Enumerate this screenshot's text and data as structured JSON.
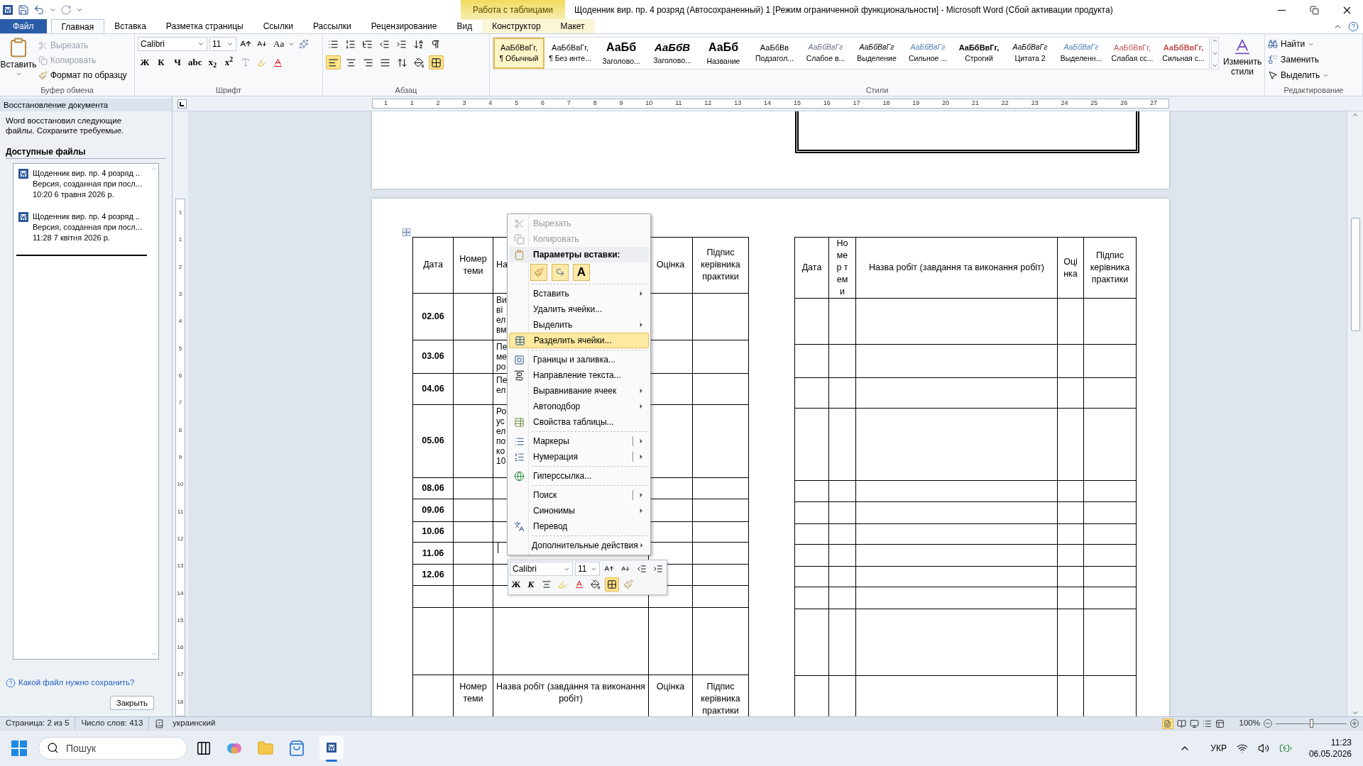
{
  "title_bar": {
    "contextual_group": "Работа с таблицами",
    "title": "Щоденник вир. пр. 4 розряд (Автосохраненный) 1 [Режим ограниченной функциональности]  -  Microsoft Word (Сбой активации продукта)"
  },
  "tabs": [
    {
      "label": "Файл",
      "kind": "file",
      "selected": false
    },
    {
      "label": "Главная",
      "kind": "normal",
      "selected": true
    },
    {
      "label": "Вставка",
      "kind": "normal",
      "selected": false
    },
    {
      "label": "Разметка страницы",
      "kind": "normal",
      "selected": false
    },
    {
      "label": "Ссылки",
      "kind": "normal",
      "selected": false
    },
    {
      "label": "Рассылки",
      "kind": "normal",
      "selected": false
    },
    {
      "label": "Рецензирование",
      "kind": "normal",
      "selected": false
    },
    {
      "label": "Вид",
      "kind": "normal",
      "selected": false
    },
    {
      "label": "Конструктор",
      "kind": "contextual",
      "selected": false
    },
    {
      "label": "Макет",
      "kind": "contextual",
      "selected": false
    }
  ],
  "ribbon": {
    "clipboard": {
      "label": "Буфер обмена",
      "paste": "Вставить",
      "cut": {
        "label": "Вырезать",
        "disabled": true
      },
      "copy": {
        "label": "Копировать",
        "disabled": true
      },
      "format_painter": "Формат по образцу"
    },
    "font": {
      "label": "Шрифт",
      "font_name": "Calibri",
      "font_size": "11",
      "case_button": "Aa",
      "style_buttons": [
        "Ж",
        "К",
        "Ч",
        "abc",
        "x$_{2}$",
        "x$^{2}$"
      ]
    },
    "paragraph": {
      "label": "Абзац",
      "align_buttons": [
        {
          "selected": true
        },
        {
          "selected": false
        },
        {
          "selected": false
        },
        {
          "selected": false
        }
      ],
      "borders_active": true
    },
    "styles": {
      "label": "Стили",
      "change_styles": "Изменить стили",
      "items": [
        {
          "preview": "АаБбВвГг,",
          "name": "¶ Обычный",
          "selected": true
        },
        {
          "preview": "АаБбВвГг,",
          "name": "¶ Без инте...",
          "selected": false
        },
        {
          "preview": "АаБб",
          "name": "Заголово...",
          "selected": false
        },
        {
          "preview": "АаБбВ",
          "name": "Заголово...",
          "selected": false
        },
        {
          "preview": "АаБб",
          "name": "Название",
          "selected": false
        },
        {
          "preview": "АаБбВв",
          "name": "Подзагол...",
          "selected": false
        },
        {
          "preview": "АаБбВвГг",
          "name": "Слабое в...",
          "selected": false
        },
        {
          "preview": "АаБбВвГг",
          "name": "Выделение",
          "selected": false
        },
        {
          "preview": "АаБбВвГг",
          "name": "Сильное ...",
          "selected": false
        },
        {
          "preview": "АаБбВвГг,",
          "name": "Строгий",
          "selected": false
        },
        {
          "preview": "АаБбВвГг",
          "name": "Цитата 2",
          "selected": false
        },
        {
          "preview": "АаБбВвГг",
          "name": "Выделенн...",
          "selected": false
        },
        {
          "preview": "АаБбВвГг,",
          "name": "Слабая сс...",
          "selected": false
        },
        {
          "preview": "АаБбВвГг,",
          "name": "Сильная с...",
          "selected": false
        }
      ]
    },
    "editing": {
      "label": "Редактирование",
      "find": "Найти",
      "replace": "Заменить",
      "select": "Выделить"
    }
  },
  "recovery_pane": {
    "title": "Восстановление документа",
    "message": "Word восстановил следующие файлы. Сохраните требуемые.",
    "heading": "Доступные файлы",
    "files": [
      {
        "name": "Щоденник вир. пр. 4 розряд ..",
        "version": "Версия, созданная при посл...",
        "time": "10:20 6 травня 2026 р."
      },
      {
        "name": "Щоденник вир. пр. 4 розряд ..",
        "version": "Версия, созданная при посл...",
        "time": "11:28 7 квітня 2026 р."
      }
    ],
    "help_link": "Какой файл нужно сохранить?",
    "close_button": "Закрыть"
  },
  "horizontal_ruler": [
    "1",
    "1",
    "2",
    "3",
    "4",
    "5",
    "6",
    "7",
    "8",
    "9",
    "10",
    "11",
    "12",
    "13",
    "14",
    "15",
    "16",
    "17",
    "18",
    "19",
    "20",
    "21",
    "22",
    "23",
    "24",
    "25",
    "26",
    "27"
  ],
  "vertical_ruler": [
    "1",
    "1",
    "2",
    "3",
    "4",
    "5",
    "6",
    "7",
    "8",
    "9",
    "10",
    "11",
    "12",
    "13",
    "14",
    "15",
    "16",
    "17",
    "18"
  ],
  "left_table": {
    "headers": [
      "Дата",
      "Номер теми",
      "На",
      "Оцінка",
      "Підпис керівника практики"
    ],
    "rows": [
      {
        "date": "02.06",
        "work": [
          "Ви",
          "ві",
          "ел",
          "вм"
        ]
      },
      {
        "date": "03.06",
        "work": [
          "Пе",
          "ме",
          "ро"
        ]
      },
      {
        "date": "04.06",
        "work": [
          "Пе",
          "ел"
        ]
      },
      {
        "date": "05.06",
        "work": [
          "Ро",
          "ус",
          "ел",
          "по",
          "ко",
          "10"
        ]
      },
      {
        "date": "08.06"
      },
      {
        "date": "09.06"
      },
      {
        "date": "10.06"
      },
      {
        "date": "11.06"
      },
      {
        "date": "12.06"
      }
    ],
    "next_headers": [
      "Номер теми",
      "Назва робіт (завдання та виконання робіт)",
      "Оцінка",
      "Підпис керівника практики"
    ]
  },
  "right_table": {
    "headers": [
      "Дата",
      "Номер теми",
      "Назва робіт (завдання та виконання робіт)",
      "Оцінка",
      "Підпис керівника практики"
    ]
  },
  "context_menu": {
    "items": [
      {
        "kind": "item",
        "label": "Вырезать",
        "disabled": true,
        "selected": false
      },
      {
        "kind": "item",
        "label": "Копировать",
        "disabled": true,
        "selected": false
      },
      {
        "kind": "header",
        "label": "Параметры вставки:"
      },
      {
        "kind": "paste_options",
        "glyph": "A"
      },
      {
        "kind": "item",
        "label": "Вставить",
        "disabled": false,
        "selected": false,
        "submenu": true,
        "group_start": true
      },
      {
        "kind": "item",
        "label": "Удалить ячейки...",
        "disabled": false,
        "selected": false
      },
      {
        "kind": "item",
        "label": "Выделить",
        "disabled": false,
        "selected": false,
        "submenu": true
      },
      {
        "kind": "item",
        "label": "Разделить ячейки...",
        "disabled": false,
        "selected": true
      },
      {
        "kind": "item",
        "label": "Границы и заливка...",
        "disabled": false,
        "selected": false,
        "group_start": true
      },
      {
        "kind": "item",
        "label": "Направление текста...",
        "disabled": false,
        "selected": false
      },
      {
        "kind": "item",
        "label": "Выравнивание ячеек",
        "disabled": false,
        "selected": false,
        "submenu": true
      },
      {
        "kind": "item",
        "label": "Автоподбор",
        "disabled": false,
        "selected": false,
        "submenu": true
      },
      {
        "kind": "item",
        "label": "Свойства таблицы...",
        "disabled": false,
        "selected": false
      },
      {
        "kind": "item",
        "label": "Маркеры",
        "disabled": false,
        "selected": false,
        "submenu": true,
        "split": true,
        "group_start": true
      },
      {
        "kind": "item",
        "label": "Нумерация",
        "disabled": false,
        "selected": false,
        "submenu": true,
        "split": true
      },
      {
        "kind": "item",
        "label": "Гиперссылка...",
        "disabled": false,
        "selected": false,
        "group_start": true
      },
      {
        "kind": "item",
        "label": "Поиск",
        "disabled": false,
        "selected": false,
        "submenu": true,
        "split": true,
        "group_start": true
      },
      {
        "kind": "item",
        "label": "Синонимы",
        "disabled": false,
        "selected": false,
        "submenu": true
      },
      {
        "kind": "item",
        "label": "Перевод",
        "disabled": false,
        "selected": false
      },
      {
        "kind": "item",
        "label": "Дополнительные действия",
        "disabled": false,
        "selected": false,
        "submenu": true,
        "group_start": true
      }
    ]
  },
  "mini_toolbar": {
    "font_name": "Calibri",
    "font_size": "11",
    "style_buttons": [
      "Ж",
      "К"
    ],
    "borders_active": true
  },
  "status_bar": {
    "page": "Страница: 2 из 5",
    "words": "Число слов: 413",
    "language": "украинский",
    "zoom": "100%",
    "zoom_slider": {
      "level": 0.5
    }
  },
  "taskbar": {
    "search_placeholder": "Пошук",
    "language": "УКР",
    "time": "11:23",
    "date": "06.05.2026"
  }
}
